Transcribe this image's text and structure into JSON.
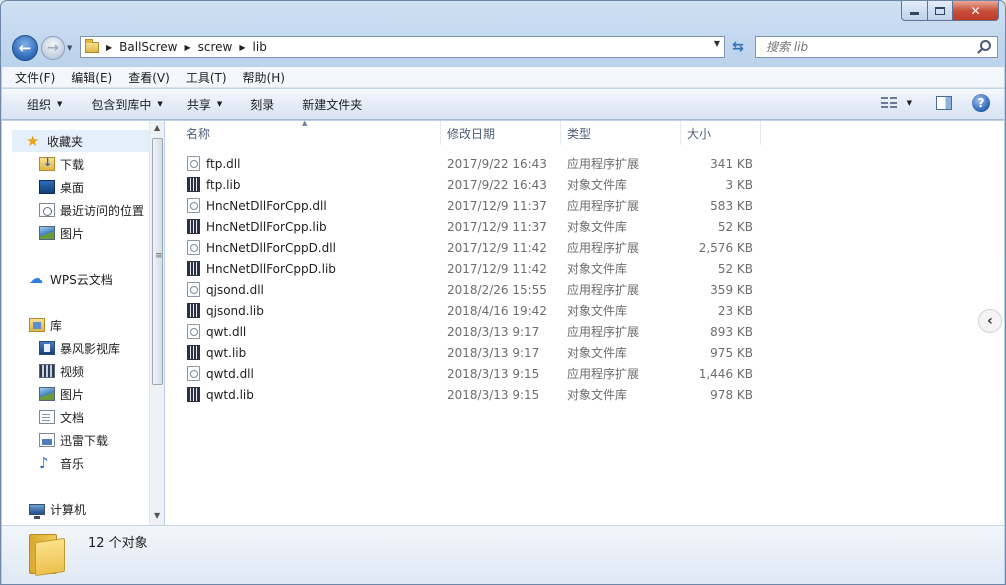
{
  "window": {
    "caption": {
      "close_glyph": "✕"
    }
  },
  "address": {
    "crumbs": [
      "BallScrew",
      "screw",
      "lib"
    ]
  },
  "search": {
    "placeholder": "搜索 lib"
  },
  "menu": [
    "文件(F)",
    "编辑(E)",
    "查看(V)",
    "工具(T)",
    "帮助(H)"
  ],
  "commands": {
    "organize": "组织",
    "include_library": "包含到库中",
    "share": "共享",
    "burn": "刻录",
    "new_folder": "新建文件夹"
  },
  "nav": {
    "favorites": "收藏夹",
    "downloads": "下载",
    "desktop": "桌面",
    "recent": "最近访问的位置",
    "pictures": "图片",
    "wps_cloud": "WPS云文档",
    "libraries": "库",
    "baofeng": "暴风影视库",
    "videos": "视频",
    "lib_pictures": "图片",
    "documents": "文档",
    "xunlei": "迅雷下载",
    "music": "音乐",
    "computer": "计算机"
  },
  "columns": {
    "name": "名称",
    "date": "修改日期",
    "type": "类型",
    "size": "大小"
  },
  "files": [
    {
      "name": "ftp.dll",
      "date": "2017/9/22 16:43",
      "type": "应用程序扩展",
      "size": "341 KB",
      "kind": "dll"
    },
    {
      "name": "ftp.lib",
      "date": "2017/9/22 16:43",
      "type": "对象文件库",
      "size": "3 KB",
      "kind": "lib"
    },
    {
      "name": "HncNetDllForCpp.dll",
      "date": "2017/12/9 11:37",
      "type": "应用程序扩展",
      "size": "583 KB",
      "kind": "dll"
    },
    {
      "name": "HncNetDllForCpp.lib",
      "date": "2017/12/9 11:37",
      "type": "对象文件库",
      "size": "52 KB",
      "kind": "lib"
    },
    {
      "name": "HncNetDllForCppD.dll",
      "date": "2017/12/9 11:42",
      "type": "应用程序扩展",
      "size": "2,576 KB",
      "kind": "dll"
    },
    {
      "name": "HncNetDllForCppD.lib",
      "date": "2017/12/9 11:42",
      "type": "对象文件库",
      "size": "52 KB",
      "kind": "lib"
    },
    {
      "name": "qjsond.dll",
      "date": "2018/2/26 15:55",
      "type": "应用程序扩展",
      "size": "359 KB",
      "kind": "dll"
    },
    {
      "name": "qjsond.lib",
      "date": "2018/4/16 19:42",
      "type": "对象文件库",
      "size": "23 KB",
      "kind": "lib"
    },
    {
      "name": "qwt.dll",
      "date": "2018/3/13 9:17",
      "type": "应用程序扩展",
      "size": "893 KB",
      "kind": "dll"
    },
    {
      "name": "qwt.lib",
      "date": "2018/3/13 9:17",
      "type": "对象文件库",
      "size": "975 KB",
      "kind": "lib"
    },
    {
      "name": "qwtd.dll",
      "date": "2018/3/13 9:15",
      "type": "应用程序扩展",
      "size": "1,446 KB",
      "kind": "dll"
    },
    {
      "name": "qwtd.lib",
      "date": "2018/3/13 9:15",
      "type": "对象文件库",
      "size": "978 KB",
      "kind": "lib"
    }
  ],
  "status": {
    "count": "12 个对象"
  }
}
